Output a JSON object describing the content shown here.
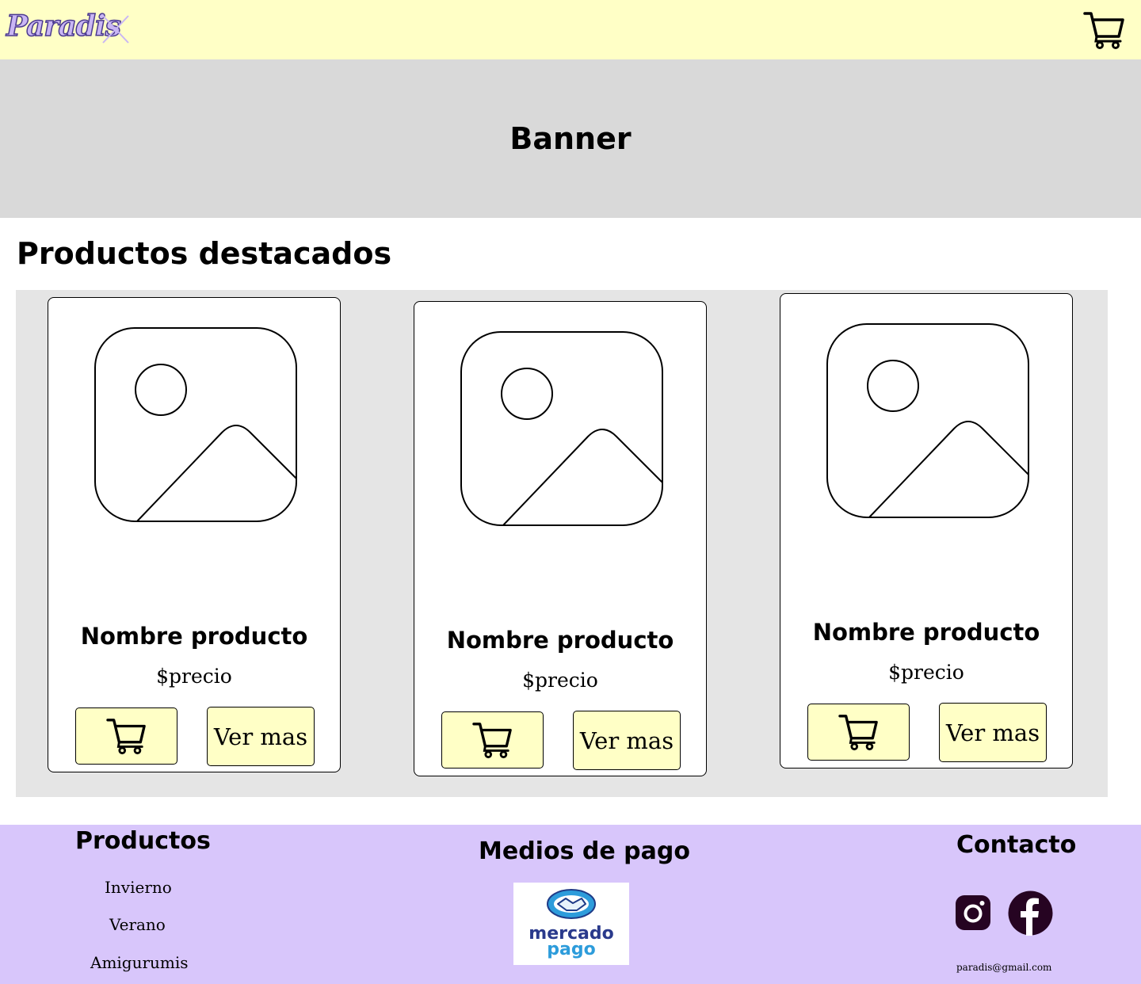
{
  "header": {
    "logo": "Paradis",
    "cart_icon": "cart-icon",
    "colors": {
      "background": "#ffffc6",
      "logo": "#c9b6f4"
    }
  },
  "banner": {
    "label": "Banner",
    "background": "#d9d9d9"
  },
  "featured": {
    "title": "Productos destacados",
    "products": [
      {
        "name": "Nombre producto",
        "price": "$precio",
        "image_icon": "image-placeholder-icon",
        "cart_icon": "cart-icon",
        "more_label": "Ver mas"
      },
      {
        "name": "Nombre producto",
        "price": "$precio",
        "image_icon": "image-placeholder-icon",
        "cart_icon": "cart-icon",
        "more_label": "Ver mas"
      },
      {
        "name": "Nombre producto",
        "price": "$precio",
        "image_icon": "image-placeholder-icon",
        "cart_icon": "cart-icon",
        "more_label": "Ver mas"
      }
    ]
  },
  "footer": {
    "background": "#d8c6fb",
    "products": {
      "title": "Productos",
      "links": [
        "Invierno",
        "Verano",
        "Amigurumis"
      ]
    },
    "payment": {
      "title": "Medios de pago",
      "logo_line1": "mercado",
      "logo_line2": "pago"
    },
    "contact": {
      "title": "Contacto",
      "icons": [
        "instagram-icon",
        "facebook-icon"
      ],
      "email": "paradis@gmail.com"
    }
  }
}
